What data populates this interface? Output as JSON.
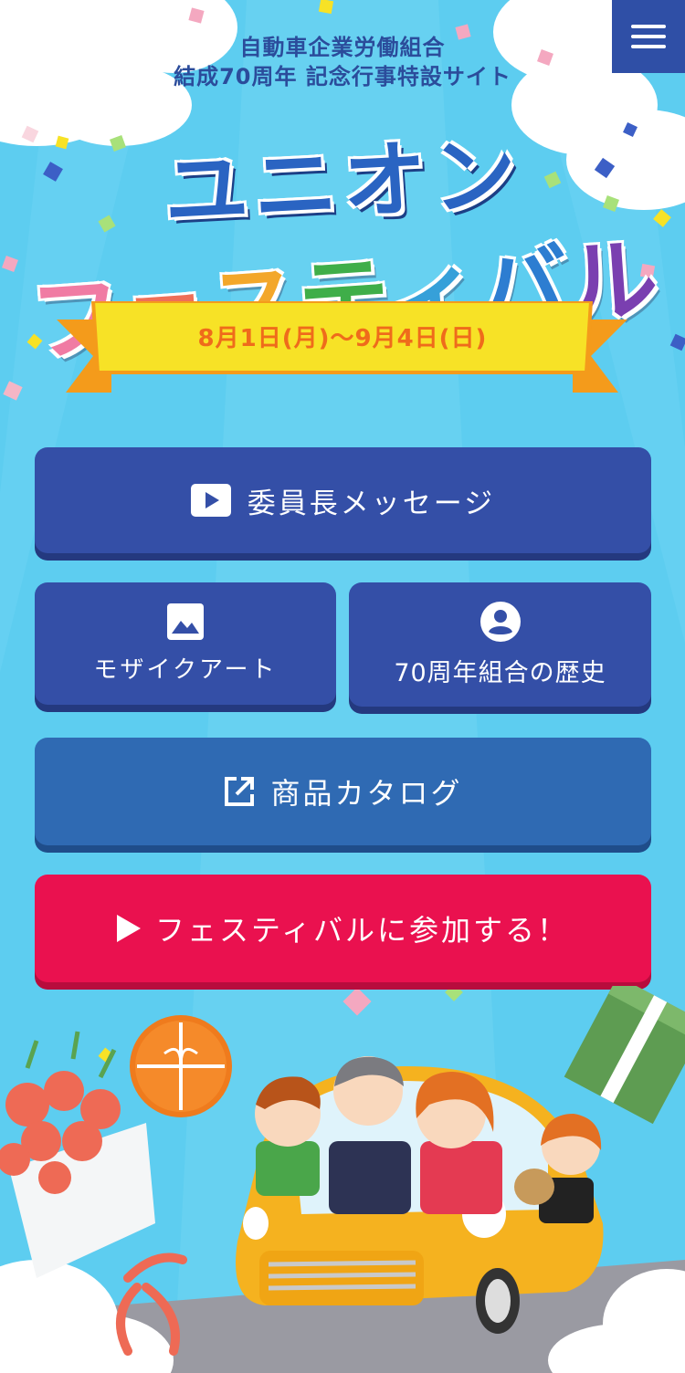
{
  "header": {
    "org_line1": "自動車企業労働組合",
    "org_line2": "結成70周年 記念行事特設サイト",
    "menu_icon": "hamburger-menu-icon"
  },
  "logo": {
    "line1": "ユニオン",
    "line2": [
      "フ",
      "ェ",
      "ス",
      "テ",
      "ィ",
      "バ",
      "ル"
    ],
    "line2_colors": [
      "#f07ba3",
      "#ee6f58",
      "#f3a72a",
      "#3fae49",
      "#36a0d9",
      "#2d7dd1",
      "#7a3fb0"
    ],
    "dates": "8月1日(月)～9月4日(日)"
  },
  "buttons": {
    "message_label": "委員長メッセージ",
    "message_icon": "play-video-icon",
    "mosaic_label": "モザイクアート",
    "mosaic_icon": "image-icon",
    "history_label": "70周年組合の歴史",
    "history_icon": "account-circle-icon",
    "catalog_label": "商品カタログ",
    "catalog_icon": "external-link-icon",
    "join_label": "フェスティバルに参加する！",
    "join_icon": "play-arrow-icon"
  },
  "colors": {
    "sky": "#5dcdf0",
    "button_blue": "#344fa7",
    "button_catalog": "#2f6ab3",
    "button_pink": "#ea114f",
    "ribbon_yellow": "#f7e226",
    "ribbon_orange": "#f49b1b",
    "date_orange": "#ef6b1b",
    "title_blue": "#2b4c9b",
    "car_yellow": "#f5b21f"
  }
}
